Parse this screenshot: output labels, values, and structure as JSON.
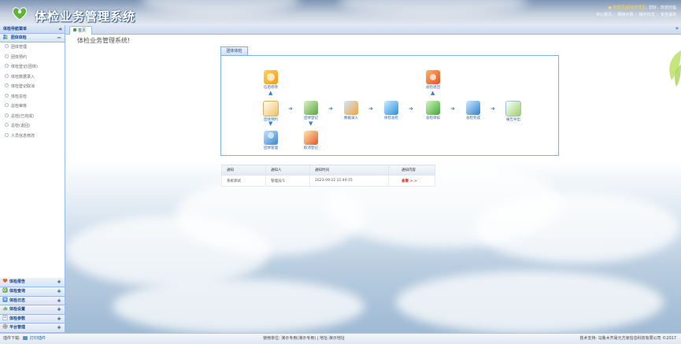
{
  "header": {
    "title": "体检业务管理系统",
    "user_name": "管理员[超级管理员]",
    "greeting": "您好，欢迎光临",
    "links": [
      "中心首页",
      "网络示例",
      "操作日志",
      "安全退出"
    ]
  },
  "sidebar": {
    "title": "体检导航菜单",
    "collapse_icon": "«",
    "active_group": "团体体检",
    "active_group_toggle": "−",
    "items": [
      "团体管理",
      "团体预约",
      "体检登记(团体)",
      "体检数据录入",
      "体检登记取消",
      "体检总检",
      "总检审核",
      "总检(已完成)",
      "总检(退回)",
      "人员信息修改"
    ],
    "bottom_groups": [
      {
        "label": "体检报告",
        "toggle": "+"
      },
      {
        "label": "体检查询",
        "toggle": "+"
      },
      {
        "label": "体检日志",
        "toggle": "+"
      },
      {
        "label": "体检设置",
        "toggle": "+"
      },
      {
        "label": "体检参数",
        "toggle": "+"
      },
      {
        "label": "平台管理",
        "toggle": "+"
      }
    ]
  },
  "tabs": {
    "active": "首页",
    "more_icon": "»"
  },
  "main": {
    "welcome": "体检业务管理系统!",
    "flow_tab": "团体体检",
    "flow": {
      "info_modify": "信息修改",
      "group_booking": "团体预约",
      "group_register": "团体登记",
      "data_entry": "数据录入",
      "exam_total": "体检总检",
      "total_review": "总检审核",
      "total_done": "总检完成",
      "report_export": "报告导出",
      "group_manage": "团体管理",
      "cancel_register": "取消登记",
      "total_return": "总检退回"
    },
    "notice": {
      "headers": [
        "通知",
        "通知人",
        "通知时间",
        "通知内容"
      ],
      "rows": [
        {
          "title": "系统调试",
          "person": "管理员/1",
          "time": "2023-09-22 11:49:15",
          "action": "查看 > >"
        }
      ]
    }
  },
  "footer": {
    "plugin_label": "插件下载:",
    "plugin_link": "打印插件",
    "center": "使用单位: 演示专用(演示专用) | 地址:演示地址",
    "right": "技术支持: 乌鲁木齐易元方家信息科技有限公司  ©2017"
  },
  "colors": {
    "header_blue": "#7e96b6",
    "panel_border": "#99bbe8",
    "link_blue": "#2a63b0",
    "view_red": "#e0301e"
  }
}
